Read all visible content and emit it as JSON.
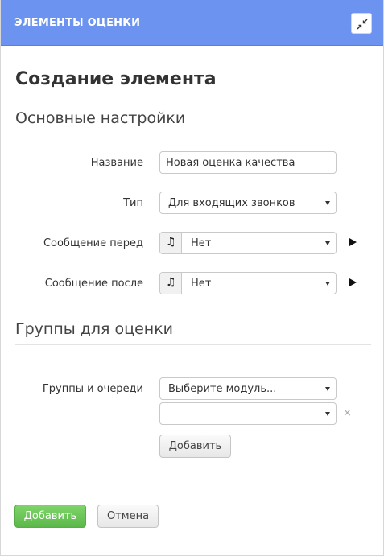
{
  "header": {
    "title": "ЭЛЕМЕНТЫ ОЦЕНКИ",
    "collapse_icon": "compress-arrows-icon"
  },
  "page": {
    "title": "Создание элемента"
  },
  "sections": {
    "basic": {
      "title": "Основные настройки"
    },
    "groups": {
      "title": "Группы для оценки"
    }
  },
  "form": {
    "name": {
      "label": "Название",
      "value": "Новая оценка качества"
    },
    "type": {
      "label": "Тип",
      "value": "Для входящих звонков"
    },
    "message_before": {
      "label": "Сообщение перед",
      "value": "Нет",
      "icon": "music-note-icon",
      "play_icon": "play-icon"
    },
    "message_after": {
      "label": "Сообщение после",
      "value": "Нет",
      "icon": "music-note-icon",
      "play_icon": "play-icon"
    },
    "groups_queues": {
      "label": "Группы и очереди",
      "module_value": "Выберите модуль...",
      "item_value": "",
      "remove_icon": "×",
      "add_label": "Добавить"
    }
  },
  "footer": {
    "submit_label": "Добавить",
    "cancel_label": "Отмена"
  },
  "colors": {
    "header": "#6b93ef",
    "success": "#5cb84a"
  }
}
